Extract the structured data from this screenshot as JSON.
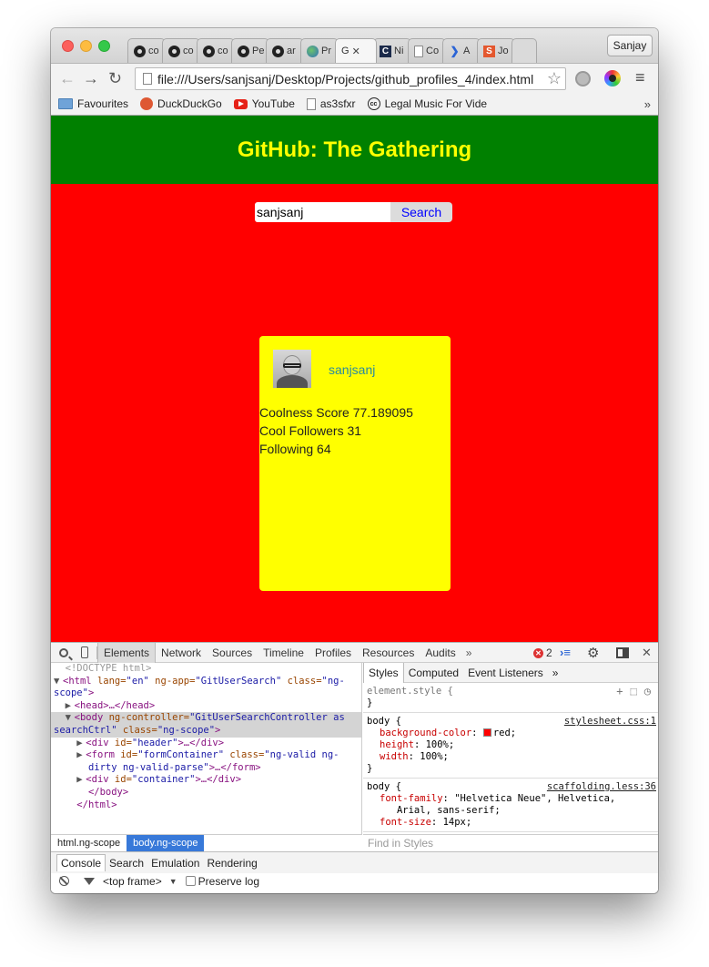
{
  "browser": {
    "profile_name": "Sanjay",
    "tabs": [
      {
        "title": "co",
        "icon": "github-icon"
      },
      {
        "title": "co",
        "icon": "github-icon"
      },
      {
        "title": "co",
        "icon": "github-icon"
      },
      {
        "title": "Pe",
        "icon": "github-icon"
      },
      {
        "title": "ar",
        "icon": "github-icon"
      },
      {
        "title": "Pr",
        "icon": "globe-icon"
      },
      {
        "title": "G",
        "icon": "document-icon",
        "active": true
      },
      {
        "title": "Ni",
        "icon": "c-logo-icon"
      },
      {
        "title": "Co",
        "icon": "document-icon"
      },
      {
        "title": "A",
        "icon": "arrow-logo-icon"
      },
      {
        "title": "Jo",
        "icon": "s-logo-icon"
      }
    ],
    "address": "file:///Users/sanjsanj/Desktop/Projects/github_profiles_4/index.html",
    "bookmarks": [
      {
        "label": "Favourites",
        "icon": "folder-icon"
      },
      {
        "label": "DuckDuckGo",
        "icon": "duckduckgo-icon"
      },
      {
        "label": "YouTube",
        "icon": "youtube-icon"
      },
      {
        "label": "as3sfxr",
        "icon": "document-icon"
      },
      {
        "label": "Legal Music For Vide",
        "icon": "creative-commons-icon"
      }
    ],
    "more_bookmarks": "»"
  },
  "page": {
    "title": "GitHub: The Gathering",
    "search_value": "sanjsanj",
    "search_button": "Search",
    "colors": {
      "header_bg": "#008000",
      "page_bg": "#ff0000",
      "title_color": "#ffff00",
      "card_bg": "#ffff00"
    },
    "card": {
      "username": "sanjsanj",
      "coolness": "Coolness Score 77.189095",
      "followers": "Cool Followers 31",
      "following": "Following 64"
    }
  },
  "devtools": {
    "tabs": [
      "Elements",
      "Network",
      "Sources",
      "Timeline",
      "Profiles",
      "Resources",
      "Audits"
    ],
    "more": "»",
    "error_count": "2",
    "dom": {
      "doctype": "<!DOCTYPE html>",
      "html_lang_attr": "lang=",
      "html_lang_val": "\"en\"",
      "html_app_attr": "ng-app=",
      "html_app_val": "\"GitUserSearch\"",
      "html_class_attr": "class=",
      "html_class_val_1": "\"ng-",
      "html_class_val_2": "scope\"",
      "head": "<head>…</head>",
      "body_ctrl_attr": "ng-controller=",
      "body_ctrl_val_1": "\"GitUserSearchController as",
      "body_ctrl_val_2": "searchCtrl\"",
      "body_class_attr": "class=",
      "body_class_val": "\"ng-scope\"",
      "header_div_attr": "id=",
      "header_div_val": "\"header\"",
      "form_id_attr": "id=",
      "form_id_val": "\"formContainer\"",
      "form_class_attr": "class=",
      "form_class_val_1": "\"ng-valid ng-",
      "form_class_val_2": "dirty ng-valid-parse\"",
      "container_attr": "id=",
      "container_val": "\"container\"",
      "close_body": "</body>",
      "close_html": "</html>"
    },
    "breadcrumbs": [
      "html.ng-scope",
      "body.ng-scope"
    ],
    "styles_tabs": [
      "Styles",
      "Computed",
      "Event Listeners"
    ],
    "styles_more": "»",
    "element_style": "element.style {",
    "rule1": {
      "selector": "body {",
      "source": "stylesheet.css:1",
      "bg_name": "background-color",
      "bg_val": "red;",
      "height_name": "height",
      "height_val": "100%;",
      "width_name": "width",
      "width_val": "100%;"
    },
    "rule2": {
      "selector": "body {",
      "source": "scaffolding.less:36",
      "font_name": "font-family",
      "font_val_1": "\"Helvetica Neue\", Helvetica,",
      "font_val_2": "Arial, sans-serif;",
      "size_name": "font-size",
      "size_val": "14px;"
    },
    "find_styles": "Find in Styles",
    "drawer_tabs": [
      "Console",
      "Search",
      "Emulation",
      "Rendering"
    ],
    "frame": "<top frame>",
    "preserve_log": "Preserve log"
  }
}
